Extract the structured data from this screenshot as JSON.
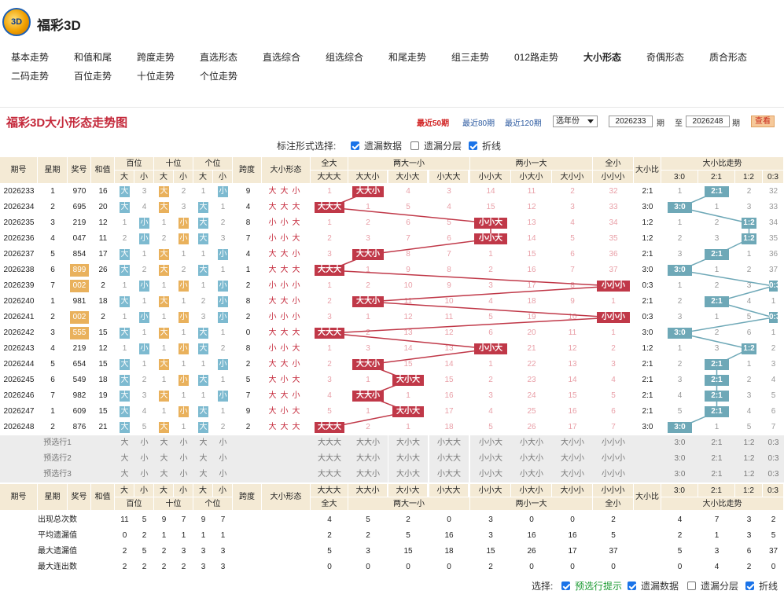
{
  "app": {
    "title": "福彩3D",
    "logo_text": "3D"
  },
  "nav": [
    "基本走势",
    "和值和尾",
    "跨度走势",
    "直选形态",
    "直选综合",
    "组选综合",
    "和尾走势",
    "组三走势",
    "012路走势",
    "大小形态",
    "奇偶形态",
    "质合形态",
    "二码走势",
    "百位走势",
    "十位走势",
    "个位走势"
  ],
  "nav_active": "大小形态",
  "panel": {
    "title": "福彩3D大小形态走势图",
    "periods": [
      "最近50期",
      "最近80期",
      "最近120期"
    ],
    "period_active": "最近50期",
    "year_select": "选年份",
    "from": "2026233",
    "to": "2026248",
    "qi": "期",
    "zhi": "至",
    "query": "查看"
  },
  "options": {
    "label": "标注形式选择:",
    "items": [
      {
        "text": "遗漏数据",
        "checked": true
      },
      {
        "text": "遗漏分层",
        "checked": false
      },
      {
        "text": "折线",
        "checked": true
      }
    ]
  },
  "headers": {
    "qihao": "期号",
    "xingqi": "星期",
    "jianghao": "奖号",
    "hezhi": "和值",
    "bai": "百位",
    "shi": "十位",
    "ge": "个位",
    "da": "大",
    "xiao": "小",
    "kuadu": "跨度",
    "xingtai": "大小形态",
    "quanda": "全大",
    "ldyx": "两大一小",
    "lxyd": "两小一大",
    "quanxiao": "全小",
    "dxb": "大小比",
    "dxbzs": "大小比走势",
    "forms": [
      "大大大",
      "大大小",
      "大小大",
      "小大大",
      "小小大",
      "小大小",
      "大小小",
      "小小小"
    ],
    "ratios": [
      "3:0",
      "2:1",
      "1:2",
      "0:3"
    ]
  },
  "rows": [
    {
      "q": "2026233",
      "w": "1",
      "n": "970",
      "s": "16",
      "p": [
        "B",
        "3",
        "B",
        "2",
        "1",
        "S"
      ],
      "k": "9",
      "f": "大大小",
      "m": [
        "1",
        "*",
        "4",
        "3",
        "14",
        "11",
        "2",
        "32"
      ],
      "r": "2:1",
      "rm": [
        "1",
        "*",
        "2",
        "32"
      ]
    },
    {
      "q": "2026234",
      "w": "2",
      "n": "695",
      "s": "20",
      "p": [
        "B",
        "4",
        "B",
        "3",
        "B",
        "1"
      ],
      "k": "4",
      "f": "大大大",
      "m": [
        "*",
        "1",
        "5",
        "4",
        "15",
        "12",
        "3",
        "33"
      ],
      "r": "3:0",
      "rm": [
        "*",
        "1",
        "3",
        "33"
      ]
    },
    {
      "q": "2026235",
      "w": "3",
      "n": "219",
      "s": "12",
      "p": [
        "1",
        "S",
        "1",
        "S",
        "B",
        "2"
      ],
      "k": "8",
      "f": "小小大",
      "m": [
        "1",
        "2",
        "6",
        "5",
        "*",
        "13",
        "4",
        "34"
      ],
      "r": "1:2",
      "rm": [
        "1",
        "2",
        "*",
        "34"
      ]
    },
    {
      "q": "2026236",
      "w": "4",
      "n": "047",
      "s": "11",
      "p": [
        "2",
        "S",
        "2",
        "S",
        "B",
        "3"
      ],
      "k": "7",
      "f": "小小大",
      "m": [
        "2",
        "3",
        "7",
        "6",
        "*",
        "14",
        "5",
        "35"
      ],
      "r": "1:2",
      "rm": [
        "2",
        "3",
        "*",
        "35"
      ]
    },
    {
      "q": "2026237",
      "w": "5",
      "n": "854",
      "s": "17",
      "p": [
        "B",
        "1",
        "B",
        "1",
        "1",
        "S"
      ],
      "k": "4",
      "f": "大大小",
      "m": [
        "3",
        "*",
        "8",
        "7",
        "1",
        "15",
        "6",
        "36"
      ],
      "r": "2:1",
      "rm": [
        "3",
        "*",
        "1",
        "36"
      ]
    },
    {
      "q": "2026238",
      "w": "6",
      "n": "899",
      "s": "26",
      "p": [
        "B",
        "2",
        "B",
        "2",
        "B",
        "1"
      ],
      "k": "1",
      "f": "大大大",
      "m": [
        "*",
        "1",
        "9",
        "8",
        "2",
        "16",
        "7",
        "37"
      ],
      "r": "3:0",
      "rm": [
        "*",
        "1",
        "2",
        "37"
      ],
      "hl": true
    },
    {
      "q": "2026239",
      "w": "7",
      "n": "002",
      "s": "2",
      "p": [
        "1",
        "S",
        "1",
        "S",
        "1",
        "S"
      ],
      "k": "2",
      "f": "小小小",
      "m": [
        "1",
        "2",
        "10",
        "9",
        "3",
        "17",
        "8",
        "*"
      ],
      "r": "0:3",
      "rm": [
        "1",
        "2",
        "3",
        "*"
      ],
      "hl": true
    },
    {
      "q": "2026240",
      "w": "1",
      "n": "981",
      "s": "18",
      "p": [
        "B",
        "1",
        "B",
        "1",
        "2",
        "S"
      ],
      "k": "8",
      "f": "大大小",
      "m": [
        "2",
        "*",
        "11",
        "10",
        "4",
        "18",
        "9",
        "1"
      ],
      "r": "2:1",
      "rm": [
        "2",
        "*",
        "4",
        "1"
      ]
    },
    {
      "q": "2026241",
      "w": "2",
      "n": "002",
      "s": "2",
      "p": [
        "1",
        "S",
        "1",
        "S",
        "3",
        "S"
      ],
      "k": "2",
      "f": "小小小",
      "m": [
        "3",
        "1",
        "12",
        "11",
        "5",
        "19",
        "10",
        "*"
      ],
      "r": "0:3",
      "rm": [
        "3",
        "1",
        "5",
        "*"
      ],
      "hl": true
    },
    {
      "q": "2026242",
      "w": "3",
      "n": "555",
      "s": "15",
      "p": [
        "B",
        "1",
        "B",
        "1",
        "B",
        "1"
      ],
      "k": "0",
      "f": "大大大",
      "m": [
        "*",
        "2",
        "13",
        "12",
        "6",
        "20",
        "11",
        "1"
      ],
      "r": "3:0",
      "rm": [
        "*",
        "2",
        "6",
        "1"
      ],
      "hl": true
    },
    {
      "q": "2026243",
      "w": "4",
      "n": "219",
      "s": "12",
      "p": [
        "1",
        "S",
        "1",
        "S",
        "B",
        "2"
      ],
      "k": "8",
      "f": "小小大",
      "m": [
        "1",
        "3",
        "14",
        "13",
        "*",
        "21",
        "12",
        "2"
      ],
      "r": "1:2",
      "rm": [
        "1",
        "3",
        "*",
        "2"
      ]
    },
    {
      "q": "2026244",
      "w": "5",
      "n": "654",
      "s": "15",
      "p": [
        "B",
        "1",
        "B",
        "1",
        "1",
        "S"
      ],
      "k": "2",
      "f": "大大小",
      "m": [
        "2",
        "*",
        "15",
        "14",
        "1",
        "22",
        "13",
        "3"
      ],
      "r": "2:1",
      "rm": [
        "2",
        "*",
        "1",
        "3"
      ]
    },
    {
      "q": "2026245",
      "w": "6",
      "n": "549",
      "s": "18",
      "p": [
        "B",
        "2",
        "1",
        "S",
        "B",
        "1"
      ],
      "k": "5",
      "f": "大小大",
      "m": [
        "3",
        "1",
        "*",
        "15",
        "2",
        "23",
        "14",
        "4"
      ],
      "r": "2:1",
      "rm": [
        "3",
        "*",
        "2",
        "4"
      ]
    },
    {
      "q": "2026246",
      "w": "7",
      "n": "982",
      "s": "19",
      "p": [
        "B",
        "3",
        "B",
        "1",
        "1",
        "S"
      ],
      "k": "7",
      "f": "大大小",
      "m": [
        "4",
        "*",
        "1",
        "16",
        "3",
        "24",
        "15",
        "5"
      ],
      "r": "2:1",
      "rm": [
        "4",
        "*",
        "3",
        "5"
      ]
    },
    {
      "q": "2026247",
      "w": "1",
      "n": "609",
      "s": "15",
      "p": [
        "B",
        "4",
        "1",
        "S",
        "B",
        "1"
      ],
      "k": "9",
      "f": "大小大",
      "m": [
        "5",
        "1",
        "*",
        "17",
        "4",
        "25",
        "16",
        "6"
      ],
      "r": "2:1",
      "rm": [
        "5",
        "*",
        "4",
        "6"
      ]
    },
    {
      "q": "2026248",
      "w": "2",
      "n": "876",
      "s": "21",
      "p": [
        "B",
        "5",
        "B",
        "1",
        "B",
        "2"
      ],
      "k": "2",
      "f": "大大大",
      "m": [
        "*",
        "2",
        "1",
        "18",
        "5",
        "26",
        "17",
        "7"
      ],
      "r": "3:0",
      "rm": [
        "*",
        "1",
        "5",
        "7"
      ]
    }
  ],
  "preselect": [
    "预选行1",
    "预选行2",
    "预选行3"
  ],
  "stats": [
    {
      "label": "出现总次数",
      "p": [
        "11",
        "5",
        "9",
        "7",
        "9",
        "7"
      ],
      "m": [
        "4",
        "5",
        "2",
        "0",
        "3",
        "0",
        "0",
        "2"
      ],
      "rm": [
        "4",
        "7",
        "3",
        "2"
      ]
    },
    {
      "label": "平均遗漏值",
      "p": [
        "0",
        "2",
        "1",
        "1",
        "1",
        "1"
      ],
      "m": [
        "2",
        "2",
        "5",
        "16",
        "3",
        "16",
        "16",
        "5"
      ],
      "rm": [
        "2",
        "1",
        "3",
        "5"
      ]
    },
    {
      "label": "最大遗漏值",
      "p": [
        "2",
        "5",
        "2",
        "3",
        "3",
        "3"
      ],
      "m": [
        "5",
        "3",
        "15",
        "18",
        "15",
        "26",
        "17",
        "37"
      ],
      "rm": [
        "5",
        "3",
        "6",
        "37"
      ]
    },
    {
      "label": "最大连出数",
      "p": [
        "2",
        "2",
        "2",
        "2",
        "3",
        "3"
      ],
      "m": [
        "0",
        "0",
        "0",
        "0",
        "2",
        "0",
        "0",
        "0"
      ],
      "rm": [
        "0",
        "4",
        "2",
        "0"
      ]
    }
  ],
  "bottom": {
    "label": "选择:",
    "items": [
      {
        "text": "预选行提示",
        "checked": true,
        "color": "#1a9a30"
      },
      {
        "text": "遗漏数据",
        "checked": true
      },
      {
        "text": "遗漏分层",
        "checked": false
      },
      {
        "text": "折线",
        "checked": true
      }
    ]
  },
  "colors": {
    "title": "#c4283a",
    "red_cell": "#c03848",
    "teal_cell": "#6ea8b7",
    "big": "#7dbad0",
    "small": "#e9b15c",
    "header": "#f4ead5"
  }
}
